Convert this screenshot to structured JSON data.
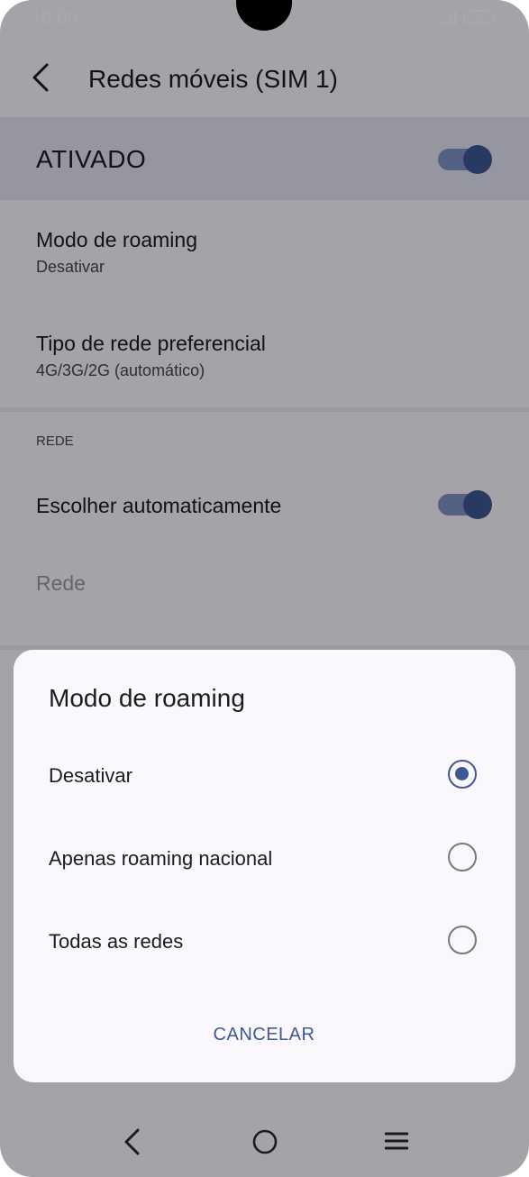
{
  "status_bar": {
    "time": "10:00",
    "battery_level": "100"
  },
  "app_bar": {
    "title": "Redes móveis (SIM 1)"
  },
  "enabled_bar": {
    "label": "ATIVADO",
    "on": true
  },
  "settings": {
    "roaming_mode": {
      "title": "Modo de roaming",
      "value": "Desativar"
    },
    "preferred_network": {
      "title": "Tipo de rede preferencial",
      "value": "4G/3G/2G (automático)"
    }
  },
  "network_section": {
    "header": "REDE",
    "auto_select": {
      "label": "Escolher automaticamente",
      "on": true
    },
    "network": {
      "label": "Rede"
    }
  },
  "dialog": {
    "title": "Modo de roaming",
    "options": [
      {
        "label": "Desativar",
        "selected": true
      },
      {
        "label": "Apenas roaming nacional",
        "selected": false
      },
      {
        "label": "Todas as redes",
        "selected": false
      }
    ],
    "cancel_label": "CANCELAR"
  },
  "colors": {
    "accent": "#3d5893",
    "switch_track": "#7e94c6",
    "enabled_bar_bg": "#e3e4f2"
  }
}
